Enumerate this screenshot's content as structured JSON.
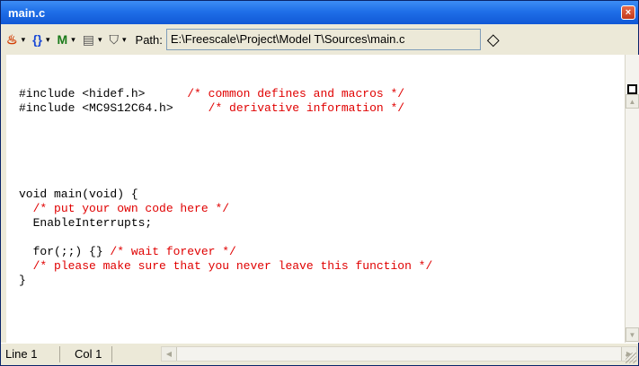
{
  "window": {
    "title": "main.c",
    "close_glyph": "×"
  },
  "toolbar": {
    "buttons": [
      {
        "icon": "flame-icon",
        "glyph": "♨",
        "color": "#d23a00"
      },
      {
        "icon": "braces-icon",
        "glyph": "{}",
        "color": "#1a4ad6"
      },
      {
        "icon": "marker-icon",
        "glyph": "M",
        "color": "#1a7a1a"
      },
      {
        "icon": "document-icon",
        "glyph": "▤",
        "color": "#555555"
      },
      {
        "icon": "lock-icon",
        "glyph": "⛉",
        "color": "#333333"
      }
    ],
    "dropdown_glyph": "▾",
    "path_label": "Path:",
    "path_value": "E:\\Freescale\\Project\\Model T\\Sources\\main.c",
    "diamond_glyph": "◇"
  },
  "code": {
    "lines": [
      {
        "code": "#include <hidef.h>      ",
        "comment": "/* common defines and macros */"
      },
      {
        "code": "#include <MC9S12C64.h>     ",
        "comment": "/* derivative information */"
      },
      {
        "code": "",
        "comment": ""
      },
      {
        "code": "",
        "comment": ""
      },
      {
        "code": "",
        "comment": ""
      },
      {
        "code": "",
        "comment": ""
      },
      {
        "code": "",
        "comment": ""
      },
      {
        "code": "void main(void) {",
        "comment": ""
      },
      {
        "code": "  ",
        "comment": "/* put your own code here */"
      },
      {
        "code": "  EnableInterrupts;",
        "comment": ""
      },
      {
        "code": "",
        "comment": ""
      },
      {
        "code": "  for(;;) {} ",
        "comment": "/* wait forever */"
      },
      {
        "code": "  ",
        "comment": "/* please make sure that you never leave this function */"
      },
      {
        "code": "}",
        "comment": ""
      }
    ]
  },
  "status": {
    "line": "Line 1",
    "col": "Col 1"
  },
  "scroll": {
    "up": "▲",
    "down": "▼",
    "left": "◀",
    "right": "▶"
  }
}
